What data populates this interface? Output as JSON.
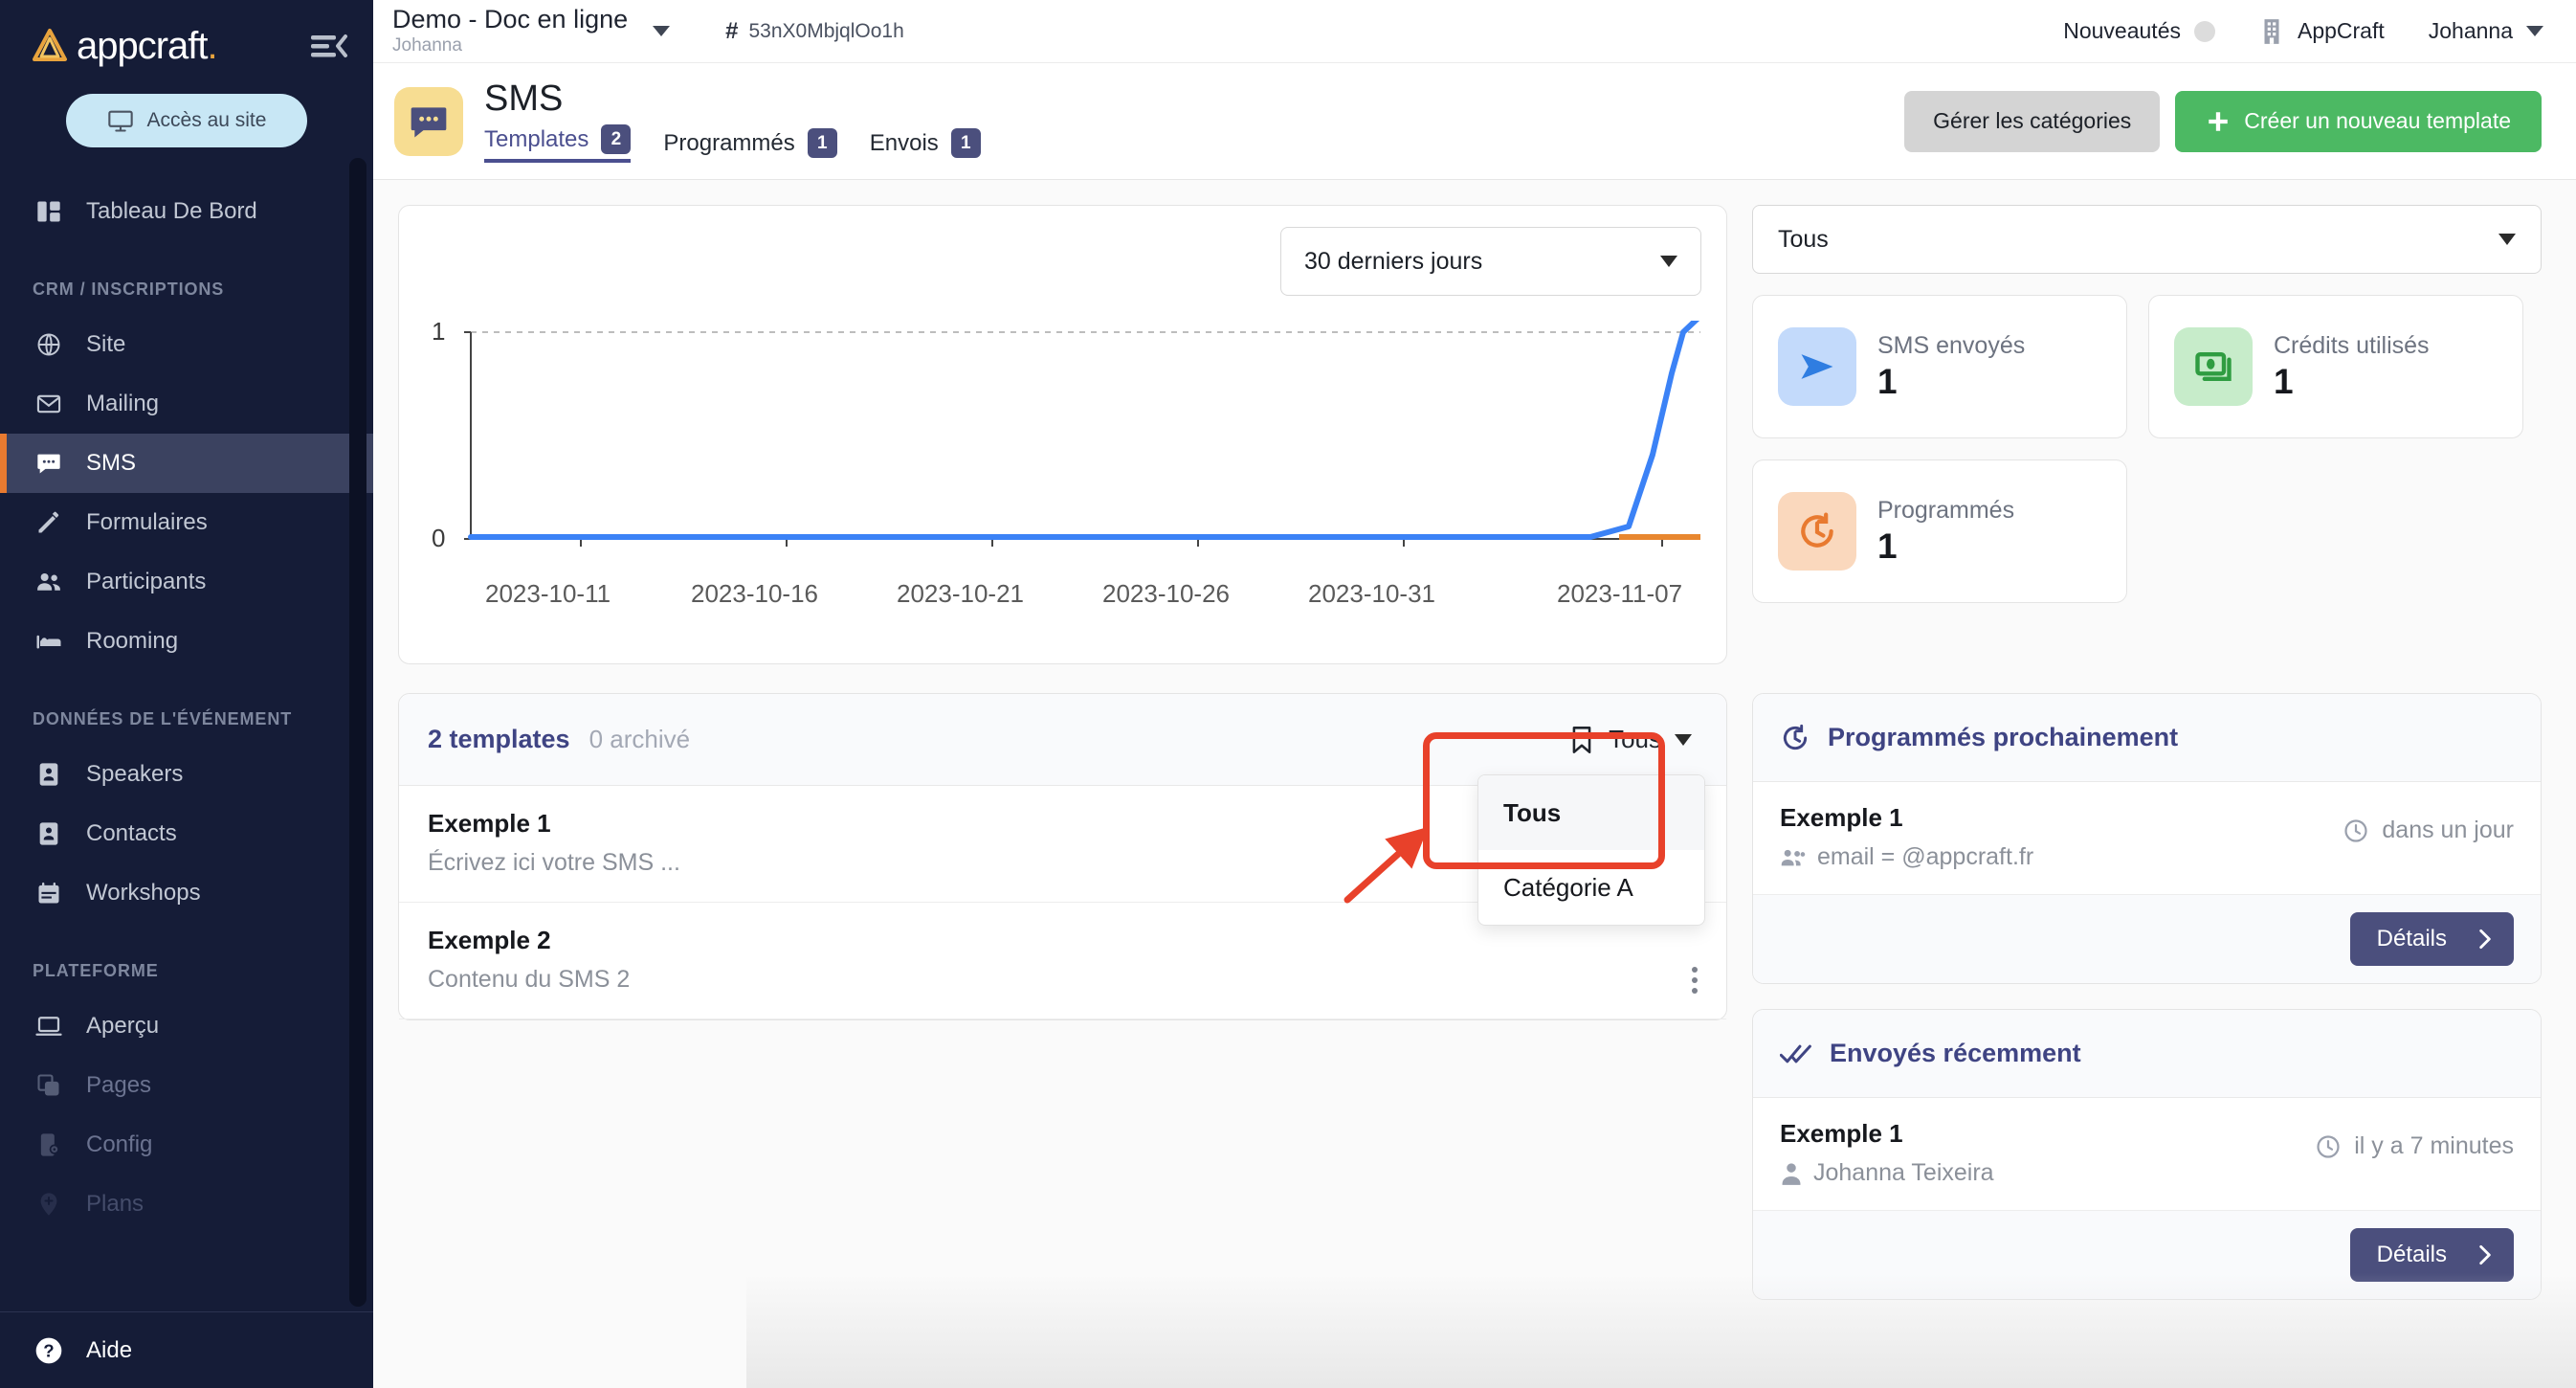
{
  "sidebar": {
    "brand": "appcraft",
    "brand_dot": ".",
    "access_button": "Accès au site",
    "items": [
      {
        "label": "Tableau De Bord",
        "icon": "dashboard-icon",
        "state": "normal"
      },
      {
        "label": "Site",
        "icon": "globe-icon",
        "state": "normal"
      },
      {
        "label": "Mailing",
        "icon": "envelope-icon",
        "state": "normal"
      },
      {
        "label": "SMS",
        "icon": "chat-icon",
        "state": "active"
      },
      {
        "label": "Formulaires",
        "icon": "pencil-icon",
        "state": "normal"
      },
      {
        "label": "Participants",
        "icon": "people-icon",
        "state": "normal"
      },
      {
        "label": "Speakers",
        "icon": "badge-icon",
        "state": "normal"
      },
      {
        "label": "Contacts",
        "icon": "contact-card-icon",
        "state": "normal"
      },
      {
        "label": "Workshops",
        "icon": "calendar-icon",
        "state": "normal"
      },
      {
        "label": "Rooming",
        "icon": "bed-icon",
        "state": "normal"
      },
      {
        "label": "Aperçu",
        "icon": "laptop-icon",
        "state": "normal"
      },
      {
        "label": "Pages",
        "icon": "copy-icon",
        "state": "dim"
      },
      {
        "label": "Config",
        "icon": "phone-gear-icon",
        "state": "dim"
      },
      {
        "label": "Plans",
        "icon": "map-pin-icon",
        "state": "dimmer"
      }
    ],
    "sections": {
      "crm": "CRM / INSCRIPTIONS",
      "event_data": "DONNÉES DE L'ÉVÉNEMENT",
      "platform": "PLATEFORME"
    },
    "help": "Aide"
  },
  "topbar": {
    "event_name": "Demo - Doc en ligne",
    "event_owner": "Johanna",
    "event_id": "53nX0MbjqlOo1h",
    "news": "Nouveautés",
    "org": "AppCraft",
    "user": "Johanna"
  },
  "pagehead": {
    "title": "SMS",
    "tabs": [
      {
        "label": "Templates",
        "count": "2",
        "active": true
      },
      {
        "label": "Programmés",
        "count": "1",
        "active": false
      },
      {
        "label": "Envois",
        "count": "1",
        "active": false
      }
    ],
    "manage_categories": "Gérer les catégories",
    "create_template": "Créer un nouveau template"
  },
  "chart_panel": {
    "range_value": "30 derniers jours",
    "category_value": "Tous",
    "stats": [
      {
        "label": "SMS envoyés",
        "value": "1",
        "icon": "send-icon",
        "bg": "#c3dafb",
        "fg": "#2f7de1"
      },
      {
        "label": "Crédits utilisés",
        "value": "1",
        "icon": "credits-icon",
        "bg": "#c7ecca",
        "fg": "#2f9c41"
      },
      {
        "label": "Programmés",
        "value": "1",
        "icon": "clock-arrow-icon",
        "bg": "#fad8bd",
        "fg": "#e87a30"
      }
    ]
  },
  "chart_data": {
    "type": "line",
    "title": "",
    "xlabel": "",
    "ylabel": "",
    "ylim": [
      0,
      1
    ],
    "yticks": [
      "0",
      "1"
    ],
    "xticks": [
      "2023-10-11",
      "2023-10-16",
      "2023-10-21",
      "2023-10-26",
      "2023-10-31",
      "2023-11-07"
    ],
    "grid": true,
    "legend": "none",
    "series": [
      {
        "name": "SMS envoyés",
        "color": "#3b82f6",
        "x": [
          "2023-10-09",
          "2023-10-11",
          "2023-10-16",
          "2023-10-21",
          "2023-10-26",
          "2023-10-31",
          "2023-11-05",
          "2023-11-06",
          "2023-11-07"
        ],
        "values": [
          0,
          0,
          0,
          0,
          0,
          0,
          0,
          0.35,
          1
        ]
      },
      {
        "name": "Crédits utilisés",
        "color": "#e8872f",
        "x": [
          "2023-11-05",
          "2023-11-06",
          "2023-11-07"
        ],
        "values": [
          0,
          0,
          0
        ]
      }
    ]
  },
  "templates_panel": {
    "count_label": "2 templates",
    "archived_label": "0 archivé",
    "filter_label": "Tous",
    "dropdown": {
      "options": [
        "Tous",
        "Catégorie A"
      ],
      "selected": "Tous"
    },
    "rows": [
      {
        "name": "Exemple 1",
        "desc": "Écrivez ici votre SMS ..."
      },
      {
        "name": "Exemple 2",
        "desc": "Contenu du SMS 2"
      }
    ]
  },
  "scheduled_panel": {
    "title": "Programmés prochainement",
    "item_name": "Exemple 1",
    "item_sub": "email = @appcraft.fr",
    "item_time": "dans un jour",
    "details": "Détails"
  },
  "sent_panel": {
    "title": "Envoyés récemment",
    "item_name": "Exemple 1",
    "item_sub": "Johanna Teixeira",
    "item_time": "il y a 7 minutes",
    "details": "Détails"
  },
  "annotation": {
    "highlight_color": "#e8412a"
  }
}
